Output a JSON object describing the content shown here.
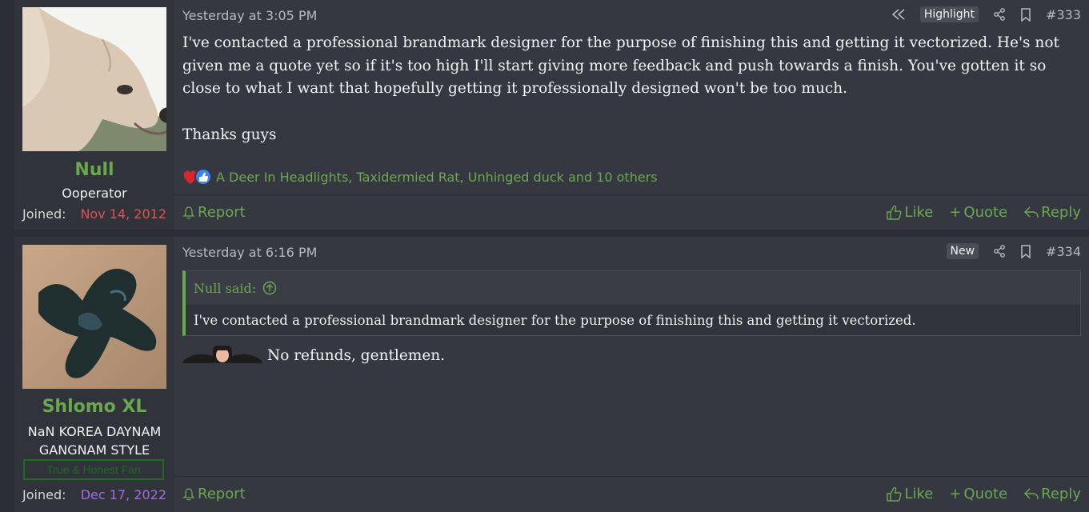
{
  "posts": [
    {
      "username": "Null",
      "user_title": "Ooperator",
      "joined_label": "Joined:",
      "joined_date": "Nov 14, 2012",
      "joined_color": "#e05252",
      "timestamp": "Yesterday at 3:05 PM",
      "badge": "Highlight",
      "post_number": "#333",
      "body": [
        "I've contacted a professional brandmark designer for the purpose of finishing this and getting it vectorized. He's not given me a quote yet so if it's too high I'll start giving more feedback and push towards a finish. You've gotten it so close to what I want that hopefully getting it professionally designed won't be too much.",
        "Thanks guys"
      ],
      "reactions_text": "A Deer In Headlights, Taxidermied Rat, Unhinged duck and 10 others",
      "report_label": "Report",
      "like_label": "Like",
      "quote_label": "Quote",
      "reply_label": "Reply"
    },
    {
      "username": "Shlomo XL",
      "user_title_1": "NaN KOREA DAYNAM",
      "user_title_2": "GANGNAM STYLE",
      "banner": "True & Honest Fan",
      "joined_label": "Joined:",
      "joined_date": "Dec 17, 2022",
      "joined_color": "#a06be0",
      "timestamp": "Yesterday at 6:16 PM",
      "badge": "New",
      "post_number": "#334",
      "quote_author": "Null said:",
      "quote_text": "I've contacted a professional brandmark designer for the purpose of finishing this and getting it vectorized.",
      "reply_text": "No refunds, gentlemen.",
      "report_label": "Report",
      "like_label": "Like",
      "quote_label": "Quote",
      "reply_label": "Reply"
    }
  ],
  "colors": {
    "accent": "#6aa84f",
    "background": "#2b2e35",
    "post_bg": "#353840"
  }
}
